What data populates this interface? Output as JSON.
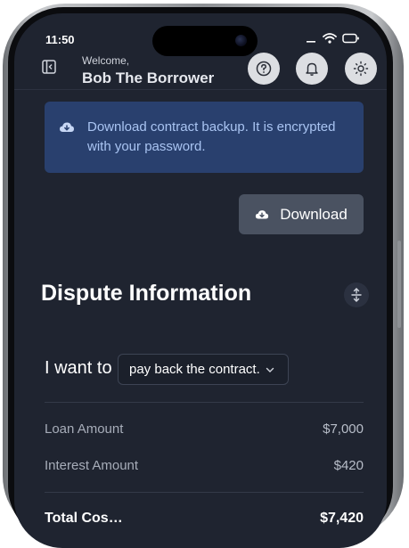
{
  "status_bar": {
    "time": "11:50",
    "icons": [
      "signal-icon",
      "wifi-icon",
      "battery-icon"
    ]
  },
  "header": {
    "welcome": "Welcome,",
    "user_name": "Bob The Borrower",
    "buttons": [
      "help-icon",
      "bell-icon",
      "sun-icon"
    ]
  },
  "alert": {
    "icon": "cloud-download-icon",
    "text": "Download contract backup. It is encrypted with your password."
  },
  "download_button": {
    "icon": "cloud-download-icon",
    "label": "Download"
  },
  "dispute": {
    "title": "Dispute Information",
    "want_label": "I want to",
    "want_selected": "pay back the contract."
  },
  "details": [
    {
      "label": "Loan Amount",
      "value": "$7,000"
    },
    {
      "label": "Interest Amount",
      "value": "$420"
    }
  ],
  "total": {
    "label": "Total Cos…",
    "value": "$7,420"
  },
  "colors": {
    "screen_bg": "#1f2430",
    "alert_bg": "#29406e",
    "alert_text": "#a9c4f2",
    "button_bg": "#4a5261"
  }
}
